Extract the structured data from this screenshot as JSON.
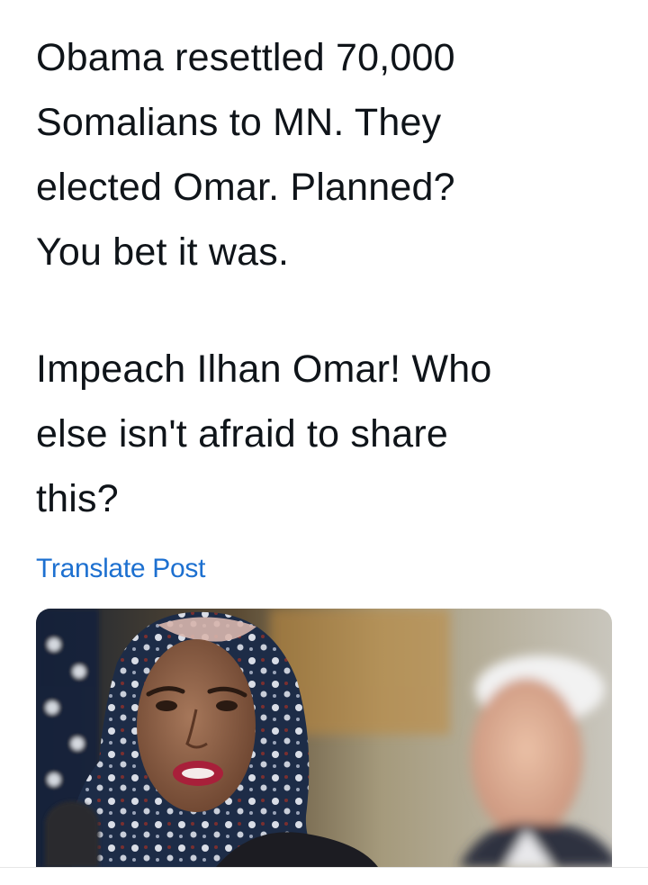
{
  "post": {
    "paragraphs": [
      {
        "lines": [
          "Obama resettled 70,000",
          "Somalians to MN. They",
          "elected Omar. Planned?",
          "You bet it was."
        ]
      },
      {
        "lines": [
          "Impeach Ilhan Omar! Who",
          "else isn't afraid to share",
          "this?"
        ]
      }
    ],
    "translate_label": "Translate Post"
  },
  "colors": {
    "text": "#0f1419",
    "link": "#1d70d0",
    "background": "#ffffff"
  },
  "media": {
    "kind": "photo",
    "content": "two-people-press-photo"
  }
}
